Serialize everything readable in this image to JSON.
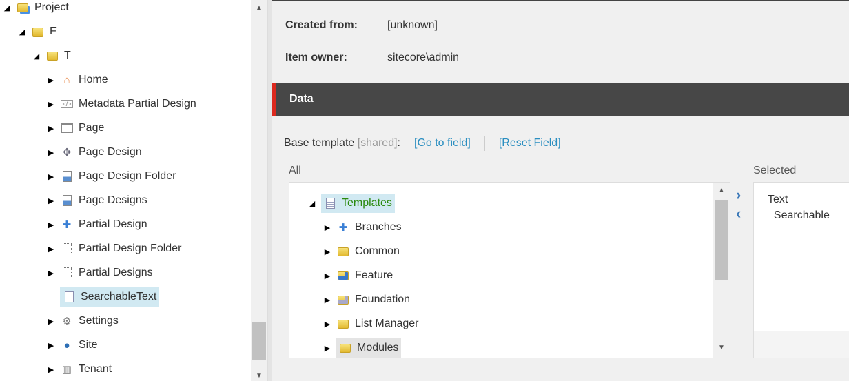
{
  "left_tree": [
    {
      "label": "Project",
      "icon": "project-folder-icon",
      "expanded": true,
      "level": 0
    },
    {
      "label": "F",
      "icon": "folder-icon",
      "expanded": true,
      "level": 1
    },
    {
      "label": "T",
      "icon": "folder-icon",
      "expanded": true,
      "level": 2
    },
    {
      "label": "Home",
      "icon": "home-icon",
      "level": 3
    },
    {
      "label": "Metadata Partial Design",
      "icon": "code-icon",
      "level": 3
    },
    {
      "label": "Page",
      "icon": "window-icon",
      "level": 3
    },
    {
      "label": "Page Design",
      "icon": "puzzle-grey-icon",
      "level": 3
    },
    {
      "label": "Page Design Folder",
      "icon": "document-chart-icon",
      "level": 3
    },
    {
      "label": "Page Designs",
      "icon": "document-chart-icon",
      "level": 3
    },
    {
      "label": "Partial Design",
      "icon": "puzzle-blue-icon",
      "level": 3
    },
    {
      "label": "Partial Design Folder",
      "icon": "dotted-document-icon",
      "level": 3
    },
    {
      "label": "Partial Designs",
      "icon": "dotted-document-icon",
      "level": 3
    },
    {
      "label": "SearchableText",
      "icon": "template-icon",
      "level": 3,
      "selected": true,
      "leaf": true
    },
    {
      "label": "Settings",
      "icon": "gear-icon",
      "level": 3
    },
    {
      "label": "Site",
      "icon": "globe-icon",
      "level": 3
    },
    {
      "label": "Tenant",
      "icon": "building-icon",
      "level": 3
    }
  ],
  "info": {
    "created_from_label": "Created from:",
    "created_from_value": "[unknown]",
    "owner_label": "Item owner:",
    "owner_value": "sitecore\\admin"
  },
  "section": {
    "title": "Data"
  },
  "field": {
    "label": "Base template",
    "shared": "[shared]",
    "colon": ":",
    "goto": "[Go to field]",
    "reset": "[Reset Field]"
  },
  "all_label": "All",
  "selected_label": "Selected",
  "template_tree": [
    {
      "label": "Templates",
      "icon": "template-icon",
      "expanded": true,
      "root": true
    },
    {
      "label": "Branches",
      "icon": "puzzle-blue-icon"
    },
    {
      "label": "Common",
      "icon": "folder-icon"
    },
    {
      "label": "Feature",
      "icon": "folder-feature-icon"
    },
    {
      "label": "Foundation",
      "icon": "folder-foundation-icon"
    },
    {
      "label": "List Manager",
      "icon": "folder-icon"
    },
    {
      "label": "Modules",
      "icon": "folder-icon",
      "hover": true
    }
  ],
  "selected_items": [
    "Text",
    "_Searchable"
  ],
  "colors": {
    "accent": "#dc291e",
    "link": "#2a8ec0",
    "header": "#474747",
    "root_green": "#2b8a0e"
  }
}
